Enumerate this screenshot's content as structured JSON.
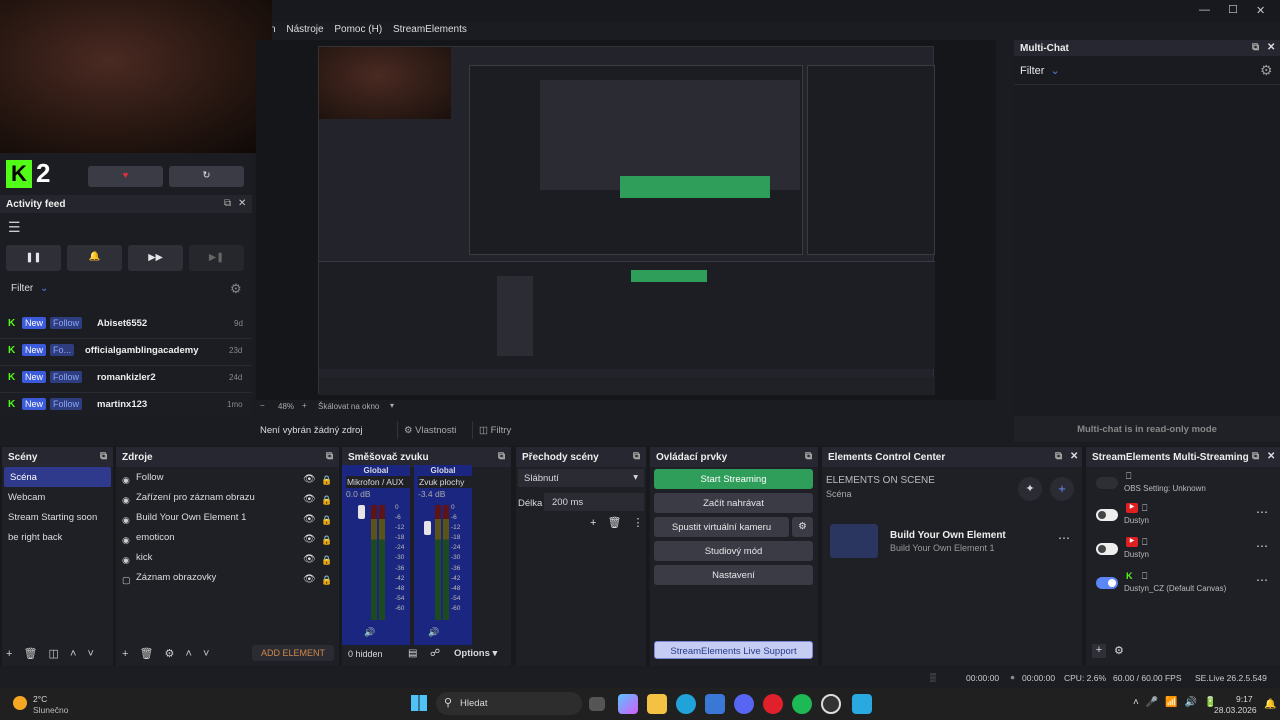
{
  "titlebar": {
    "minimize": "—",
    "maximize": "☐",
    "close": "✕"
  },
  "menubar": {
    "items": [
      "n",
      "Nástroje",
      "Pomoc (H)",
      "StreamElements"
    ]
  },
  "activity_feed": {
    "title": "Activity feed",
    "filter": "Filter",
    "rows": [
      {
        "badge": "New",
        "action": "Follow",
        "name": "Abiset6552",
        "age": "9d"
      },
      {
        "badge": "New",
        "action": "Fo...",
        "name": "officialgamblingacademy",
        "age": "23d"
      },
      {
        "badge": "New",
        "action": "Follow",
        "name": "romankizler2",
        "age": "24d"
      },
      {
        "badge": "New",
        "action": "Follow",
        "name": "martinx123",
        "age": "1mo"
      }
    ]
  },
  "logo": {
    "text": "2"
  },
  "preview": {
    "zoom": "48%",
    "scale_label": "Škálovat na okno"
  },
  "source_bar": {
    "no_source": "Není vybrán žádný zdroj",
    "properties": "Vlastnosti",
    "filters": "Filtry"
  },
  "multichat": {
    "title": "Multi-Chat",
    "filter": "Filter",
    "footer": "Multi-chat is in read-only mode"
  },
  "scenes": {
    "title": "Scény",
    "items": [
      "Scéna",
      "Webcam",
      "Stream Starting soon",
      "be right back"
    ]
  },
  "sources": {
    "title": "Zdroje",
    "items": [
      "Follow",
      "Zařízení pro záznam obrazu",
      "Build Your Own Element 1",
      "emoticon",
      "kick",
      "Záznam obrazovky"
    ],
    "add_element": "ADD ELEMENT"
  },
  "mixer": {
    "title": "Směšovač zvuku",
    "channels": [
      {
        "global": "Global",
        "name": "Mikrofon / AUX",
        "db": "0.0 dB"
      },
      {
        "global": "Global",
        "name": "Zvuk plochy",
        "db": "-3.4 dB"
      }
    ],
    "scale": [
      "0",
      "-6",
      "-12",
      "-18",
      "-24",
      "-30",
      "-36",
      "-42",
      "-48",
      "-54",
      "-60"
    ],
    "hidden": "0 hidden",
    "options": "Options"
  },
  "transitions": {
    "title": "Přechody scény",
    "type": "Slábnutí",
    "duration_label": "Délka",
    "duration": "200 ms"
  },
  "controls": {
    "title": "Ovládací prvky",
    "start": "Start Streaming",
    "record": "Začít nahrávat",
    "vcam": "Spustit virtuální kameru",
    "studio": "Studiový mód",
    "settings": "Nastavení",
    "support": "StreamElements Live Support"
  },
  "ecc": {
    "title": "Elements Control Center",
    "heading": "ELEMENTS ON SCENE",
    "scene": "Scéna",
    "item_title": "Build Your Own Element",
    "item_sub": "Build Your Own Element 1"
  },
  "multistream": {
    "title": "StreamElements Multi-Streaming",
    "rows": [
      {
        "label": "OBS Setting: Unknown",
        "on": false
      },
      {
        "label": "Dustyn",
        "on": false
      },
      {
        "label": "Dustyn",
        "on": false
      },
      {
        "label": "Dustyn_CZ (Default Canvas)",
        "on": true
      }
    ]
  },
  "statusbar": {
    "time1": "00:00:00",
    "time2": "00:00:00",
    "cpu": "CPU: 2.6%",
    "fps": "60.00 / 60.00 FPS",
    "version": "SE.Live 26.2.5.549"
  },
  "taskbar": {
    "temp": "2°C",
    "weather": "Slunečno",
    "search": "Hledat",
    "time": "9:17",
    "date": "28.03.2026"
  },
  "colors": {
    "accent_green": "#2f9e5a",
    "kick_green": "#53fc18",
    "badge_blue": "#3b5bdb"
  }
}
